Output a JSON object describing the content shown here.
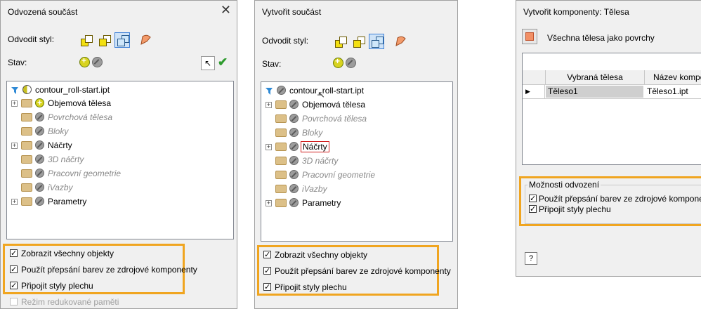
{
  "panel1": {
    "title": "Odvozená součást",
    "style_label": "Odvodit styl:",
    "status_label": "Stav:",
    "tree": [
      {
        "label": "contour_roll-start.ipt",
        "status": "half",
        "root": true
      },
      {
        "label": "Objemová tělesa",
        "status": "yellow",
        "expand": true
      },
      {
        "label": "Povrchová tělesa",
        "status": "grey",
        "dim": true
      },
      {
        "label": "Bloky",
        "status": "grey",
        "dim": true
      },
      {
        "label": "Náčrty",
        "status": "grey",
        "expand": true
      },
      {
        "label": "3D náčrty",
        "status": "grey",
        "dim": true
      },
      {
        "label": "Pracovní geometrie",
        "status": "grey",
        "dim": true
      },
      {
        "label": "iVazby",
        "status": "grey",
        "dim": true
      },
      {
        "label": "Parametry",
        "status": "grey",
        "expand": true
      }
    ],
    "options": [
      {
        "label": "Zobrazit všechny objekty",
        "checked": true
      },
      {
        "label": "Použít přepsání barev ze zdrojové komponenty",
        "checked": true
      },
      {
        "label": "Připojit styly plechu",
        "checked": true
      }
    ],
    "extra_option": "Režim redukované paměti"
  },
  "panel2": {
    "title": "Vytvořit součást",
    "style_label": "Odvodit styl:",
    "status_label": "Stav:",
    "tree": [
      {
        "label": "contour_roll-start.ipt",
        "status": "grey",
        "root": true
      },
      {
        "label": "Objemová tělesa",
        "status": "grey",
        "expand": true
      },
      {
        "label": "Povrchová tělesa",
        "status": "grey",
        "dim": true
      },
      {
        "label": "Bloky",
        "status": "grey",
        "dim": true
      },
      {
        "label": "Náčrty",
        "status": "grey",
        "expand": true,
        "boxed": true
      },
      {
        "label": "3D náčrty",
        "status": "grey",
        "dim": true
      },
      {
        "label": "Pracovní geometrie",
        "status": "grey",
        "dim": true
      },
      {
        "label": "iVazby",
        "status": "grey",
        "dim": true
      },
      {
        "label": "Parametry",
        "status": "grey",
        "expand": true
      }
    ],
    "options": [
      {
        "label": "Zobrazit všechny objekty",
        "checked": true
      },
      {
        "label": "Použít přepsání barev ze zdrojové komponenty",
        "checked": true
      },
      {
        "label": "Připojit styly plechu",
        "checked": true
      }
    ]
  },
  "panel3": {
    "title": "Vytvořit komponenty: Tělesa",
    "all_bodies_label": "Všechna tělesa jako povrchy",
    "grid_headers": [
      "Vybraná tělesa",
      "Název kompon"
    ],
    "grid_rows": [
      {
        "body": "Těleso1",
        "name": "Těleso1.ipt"
      }
    ],
    "group_title": "Možnosti odvození",
    "options": [
      {
        "label": "Použít přepsání barev ze zdrojové komponenty",
        "checked": true
      },
      {
        "label": "Připojit styly plechu",
        "checked": true
      }
    ],
    "help_button": "?"
  },
  "colors": {
    "highlight": "#f0a520",
    "selection": "#3c7fd6",
    "boxed_node": "#d02020"
  }
}
